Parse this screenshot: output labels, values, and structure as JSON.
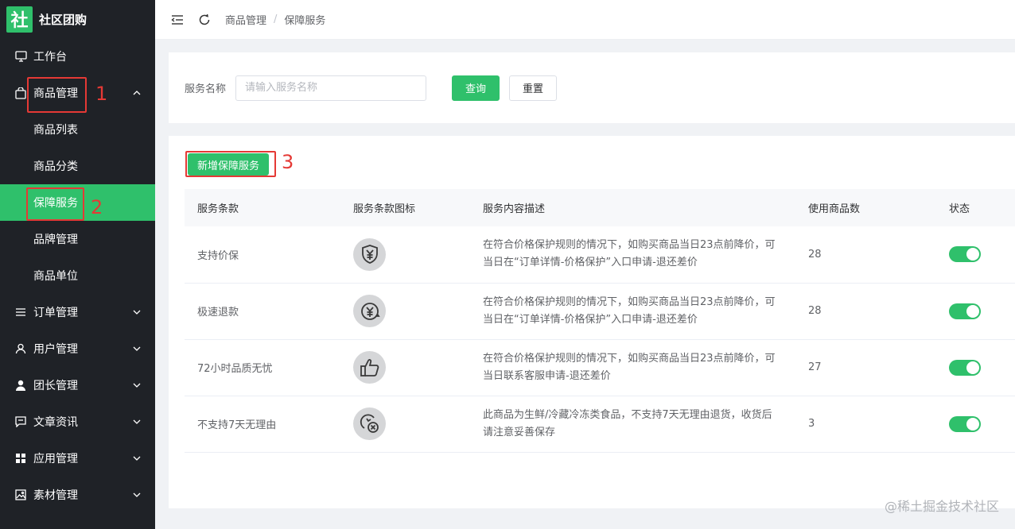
{
  "brand": {
    "logo_char": "社",
    "name": "社区团购"
  },
  "sidebar": {
    "items": [
      {
        "label": "工作台",
        "icon": "monitor-icon"
      },
      {
        "label": "商品管理",
        "icon": "bag-icon",
        "expanded": true,
        "children": [
          {
            "label": "商品列表"
          },
          {
            "label": "商品分类"
          },
          {
            "label": "保障服务",
            "active": true
          },
          {
            "label": "品牌管理"
          },
          {
            "label": "商品单位"
          }
        ]
      },
      {
        "label": "订单管理",
        "icon": "list-icon"
      },
      {
        "label": "用户管理",
        "icon": "user-icon"
      },
      {
        "label": "团长管理",
        "icon": "person-filled-icon"
      },
      {
        "label": "文章资讯",
        "icon": "chat-icon"
      },
      {
        "label": "应用管理",
        "icon": "grid-icon"
      },
      {
        "label": "素材管理",
        "icon": "image-icon"
      }
    ]
  },
  "annotations": {
    "n1": "1",
    "n2": "2",
    "n3": "3"
  },
  "header": {
    "breadcrumb": [
      "商品管理",
      "保障服务"
    ]
  },
  "search": {
    "label": "服务名称",
    "placeholder": "请输入服务名称",
    "query_label": "查询",
    "reset_label": "重置"
  },
  "table": {
    "add_button": "新增保障服务",
    "columns": [
      "服务条款",
      "服务条款图标",
      "服务内容描述",
      "使用商品数",
      "状态"
    ],
    "rows": [
      {
        "term": "支持价保",
        "icon": "shield-yen-icon",
        "desc": "在符合价格保护规则的情况下，如购买商品当日23点前降价，可当日在“订单详情-价格保护”入口申请-退还差价",
        "count": "28",
        "enabled": true
      },
      {
        "term": "极速退款",
        "icon": "yen-refresh-icon",
        "desc": "在符合价格保护规则的情况下，如购买商品当日23点前降价，可当日在“订单详情-价格保护”入口申请-退还差价",
        "count": "28",
        "enabled": true
      },
      {
        "term": "72小时品质无忧",
        "icon": "thumbs-up-icon",
        "desc": "在符合价格保护规则的情况下，如购买商品当日23点前降价，可当日联系客服申请-退还差价",
        "count": "27",
        "enabled": true
      },
      {
        "term": "不支持7天无理由",
        "icon": "no-return-icon",
        "desc": "此商品为生鲜/冷藏冷冻类食品，不支持7天无理由退货，收货后请注意妥善保存",
        "count": "3",
        "enabled": true
      }
    ]
  },
  "watermark": "@稀土掘金技术社区",
  "colors": {
    "accent": "#2fc06b",
    "sidebar_bg": "#1f2227",
    "annotation_red": "#e53935"
  }
}
